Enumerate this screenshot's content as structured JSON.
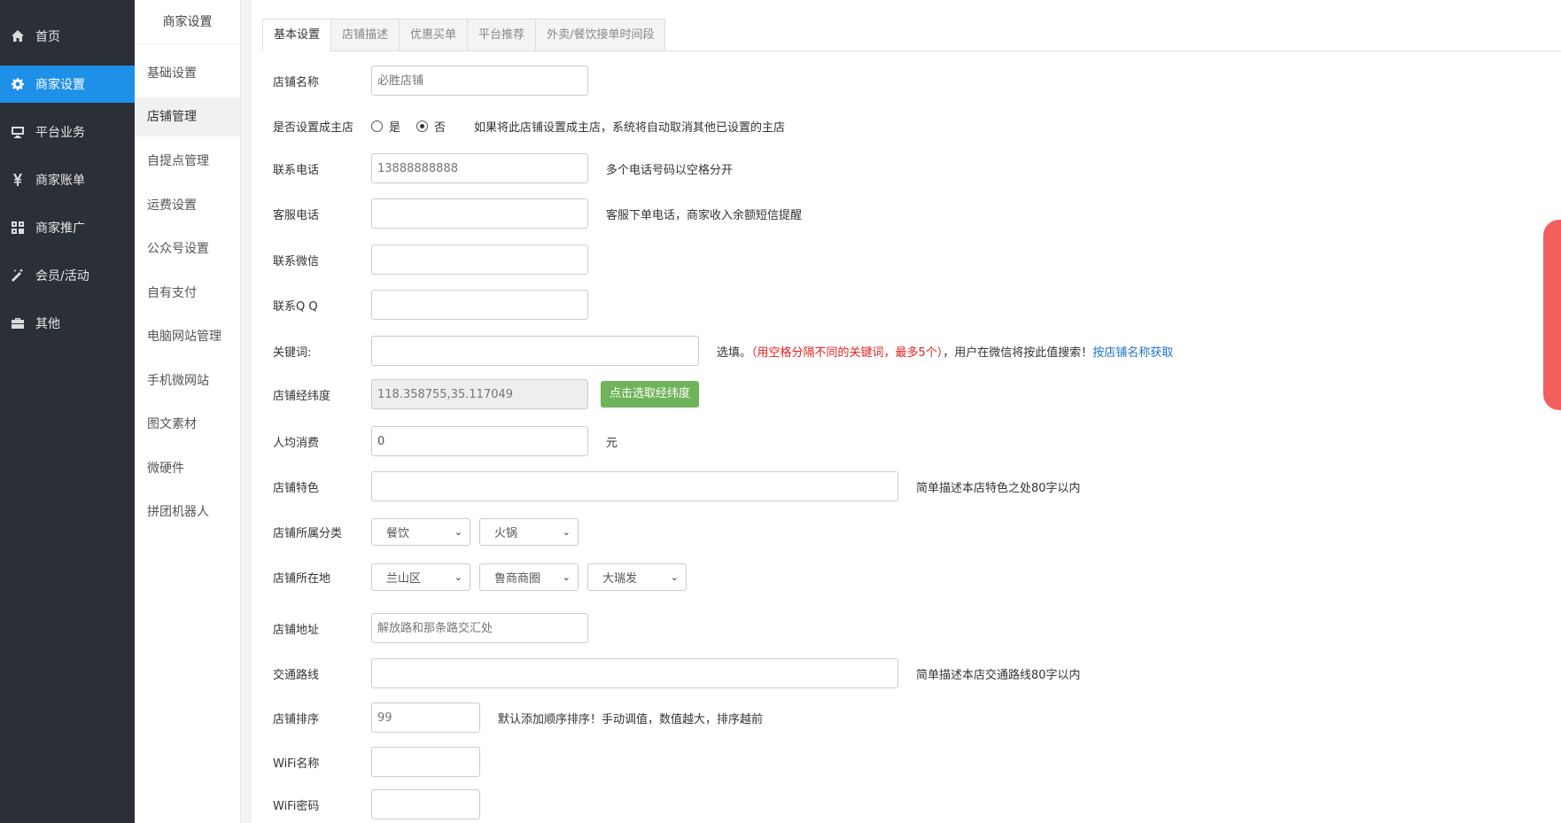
{
  "sidebar": {
    "items": [
      {
        "label": "首页",
        "icon": "home-icon"
      },
      {
        "label": "商家设置",
        "icon": "gear-icon"
      },
      {
        "label": "平台业务",
        "icon": "monitor-icon"
      },
      {
        "label": "商家账单",
        "icon": "yen-icon"
      },
      {
        "label": "商家推广",
        "icon": "grid-icon"
      },
      {
        "label": "会员/活动",
        "icon": "magic-wand-icon"
      },
      {
        "label": "其他",
        "icon": "briefcase-icon"
      }
    ],
    "active_index": 1,
    "active_color": "#1e90e8"
  },
  "submenu": {
    "title": "商家设置",
    "items": [
      "基础设置",
      "店铺管理",
      "自提点管理",
      "运费设置",
      "公众号设置",
      "自有支付",
      "电脑网站管理",
      "手机微网站",
      "图文素材",
      "微硬件",
      "拼团机器人"
    ],
    "active_index": 1
  },
  "tabs": [
    "基本设置",
    "店铺描述",
    "优惠买单",
    "平台推荐",
    "外卖/餐饮接单时间段"
  ],
  "active_tab": 0,
  "form": {
    "shop_name": {
      "label": "店铺名称",
      "placeholder": "必胜店铺"
    },
    "main_store": {
      "label": "是否设置成主店",
      "yes": "是",
      "no": "否",
      "selected": "否",
      "hint": "如果将此店铺设置成主店，系统将自动取消其他已设置的主店"
    },
    "phone": {
      "label": "联系电话",
      "placeholder": "13888888888",
      "hint": "多个电话号码以空格分开"
    },
    "service_phone": {
      "label": "客服电话",
      "value": "",
      "hint": "客服下单电话，商家收入余额短信提醒"
    },
    "wechat": {
      "label": "联系微信",
      "value": ""
    },
    "qq": {
      "label": "联系Q Q",
      "value": ""
    },
    "keywords": {
      "label": "关键词:",
      "value": "",
      "hint_prefix": "选填。",
      "hint_red": "（用空格分隔不同的关键词，最多5个）",
      "hint_mid": "，用户在微信将按此值搜索！",
      "hint_link": "按店铺名称获取"
    },
    "coords": {
      "label": "店铺经纬度",
      "value": "118.358755,35.117049",
      "button": "点击选取经纬度",
      "button_color": "#6fb35a"
    },
    "avg_spend": {
      "label": "人均消费",
      "value": "0",
      "unit": "元"
    },
    "feature": {
      "label": "店铺特色",
      "value": "",
      "hint": "简单描述本店特色之处80字以内"
    },
    "category": {
      "label": "店铺所属分类",
      "options": [
        "餐饮",
        "火锅"
      ]
    },
    "location": {
      "label": "店铺所在地",
      "options": [
        "兰山区",
        "鲁商商圈",
        "大瑞发"
      ]
    },
    "address": {
      "label": "店铺地址",
      "placeholder": "解放路和那条路交汇处"
    },
    "traffic": {
      "label": "交通路线",
      "value": "",
      "hint": "简单描述本店交通路线80字以内"
    },
    "sort": {
      "label": "店铺排序",
      "placeholder": "99",
      "hint": "默认添加顺序排序！手动调值，数值越大，排序越前"
    },
    "wifi_name": {
      "label": "WiFi名称",
      "value": ""
    },
    "wifi_password": {
      "label": "WiFi密码",
      "value": ""
    }
  }
}
